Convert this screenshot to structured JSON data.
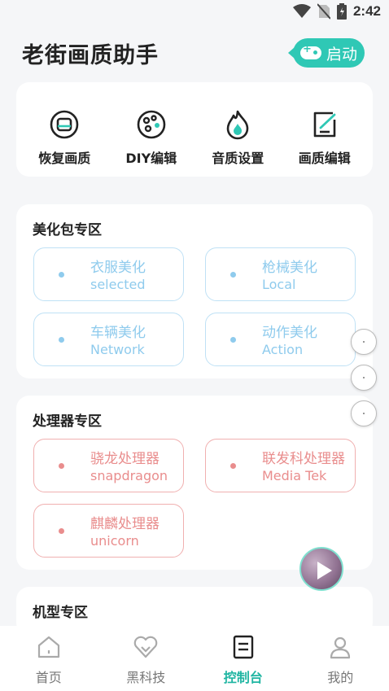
{
  "status_bar": {
    "time": "2:42"
  },
  "header": {
    "title": "老街画质助手",
    "start_label": "启动"
  },
  "quick_actions": [
    {
      "label": "恢复画质",
      "icon": "restore-icon"
    },
    {
      "label": "DIY编辑",
      "icon": "palette-icon"
    },
    {
      "label": "音质设置",
      "icon": "flame-icon"
    },
    {
      "label": "画质编辑",
      "icon": "edit-icon"
    }
  ],
  "beautify": {
    "title": "美化包专区",
    "items": [
      {
        "name": "衣服美化",
        "sub": "selected"
      },
      {
        "name": "枪械美化",
        "sub": "Local"
      },
      {
        "name": "车辆美化",
        "sub": "Network"
      },
      {
        "name": "动作美化",
        "sub": "Action"
      }
    ]
  },
  "processor": {
    "title": "处理器专区",
    "items": [
      {
        "name": "骁龙处理器",
        "sub": "snapdragon"
      },
      {
        "name": "联发科处理器",
        "sub": "Media Tek"
      },
      {
        "name": "麒麟处理器",
        "sub": "unicorn"
      }
    ]
  },
  "model": {
    "title": "机型专区"
  },
  "nav": {
    "items": [
      {
        "label": "首页",
        "icon": "home-icon"
      },
      {
        "label": "黑科技",
        "icon": "heart-icon"
      },
      {
        "label": "控制台",
        "icon": "console-icon"
      },
      {
        "label": "我的",
        "icon": "user-icon"
      }
    ],
    "active_index": 2
  },
  "colors": {
    "accent": "#2fc8b5",
    "active_nav": "#1fb5a2",
    "blue_chip": "#8fcbed",
    "red_chip": "#e98d8d"
  }
}
